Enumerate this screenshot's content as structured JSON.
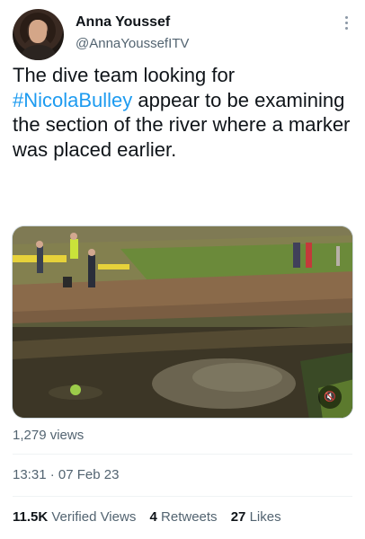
{
  "author": {
    "name": "Anna Youssef",
    "handle": "@AnnaYoussefITV"
  },
  "tweet": {
    "text_before": "The dive team looking for ",
    "hashtag": "#NicolaBulley",
    "text_after": " appear to be examining the section of the river where a marker was placed earlier."
  },
  "media": {
    "mute_icon": "speaker-muted-icon",
    "mute_glyph": "🔇"
  },
  "meta": {
    "views": "1,279 views",
    "timestamp": "13:31 · 07 Feb 23"
  },
  "stats": {
    "verified_views_count": "11.5K",
    "verified_views_label": "Verified Views",
    "retweets_count": "4",
    "retweets_label": "Retweets",
    "likes_count": "27",
    "likes_label": "Likes"
  },
  "colors": {
    "hashtag": "#1d9bf0",
    "secondary_text": "#536471",
    "primary_text": "#0f1419",
    "divider": "#eff3f4"
  }
}
